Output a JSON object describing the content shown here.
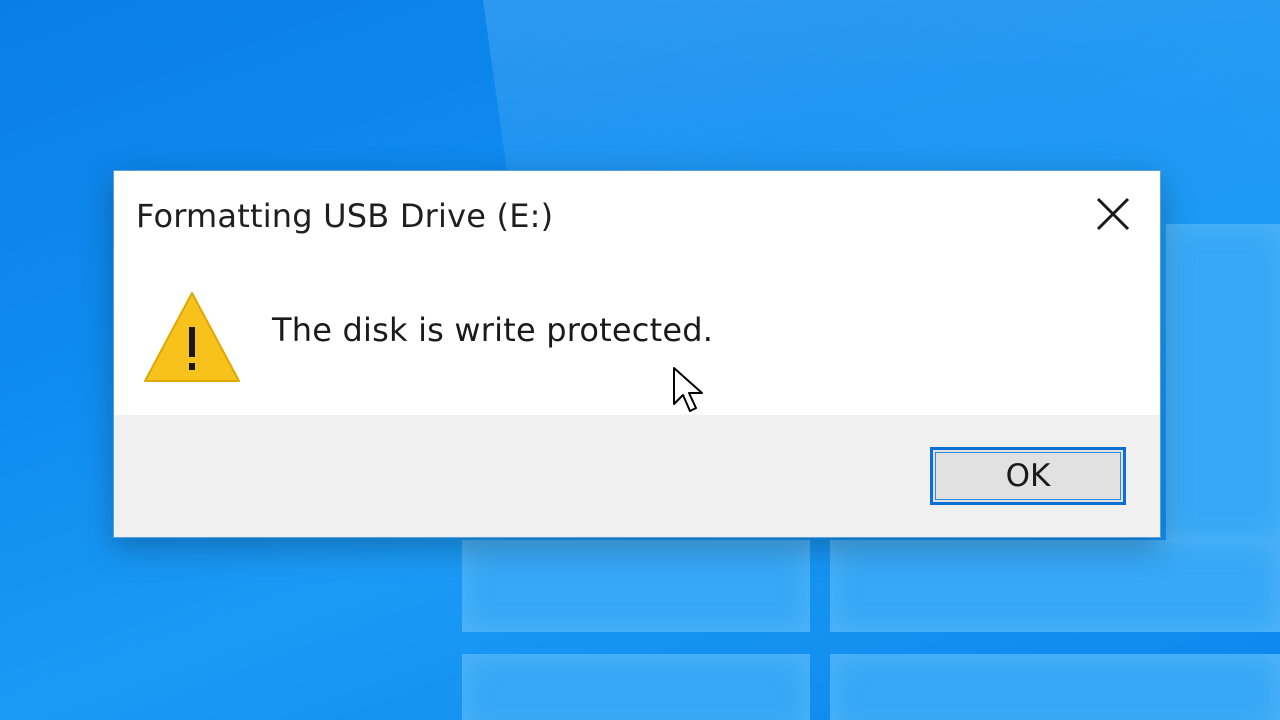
{
  "dialog": {
    "title": "Formatting USB Drive (E:)",
    "message": "The disk is write protected.",
    "ok_label": "OK",
    "icon": "warning-icon",
    "close_icon": "close-icon"
  },
  "colors": {
    "desktop_accent": "#0f8cf0",
    "button_focus_border": "#0a6fd6",
    "warning_yellow": "#f7c21b",
    "footer_bg": "#f0f0f0"
  },
  "pointer": "arrow-cursor-icon"
}
